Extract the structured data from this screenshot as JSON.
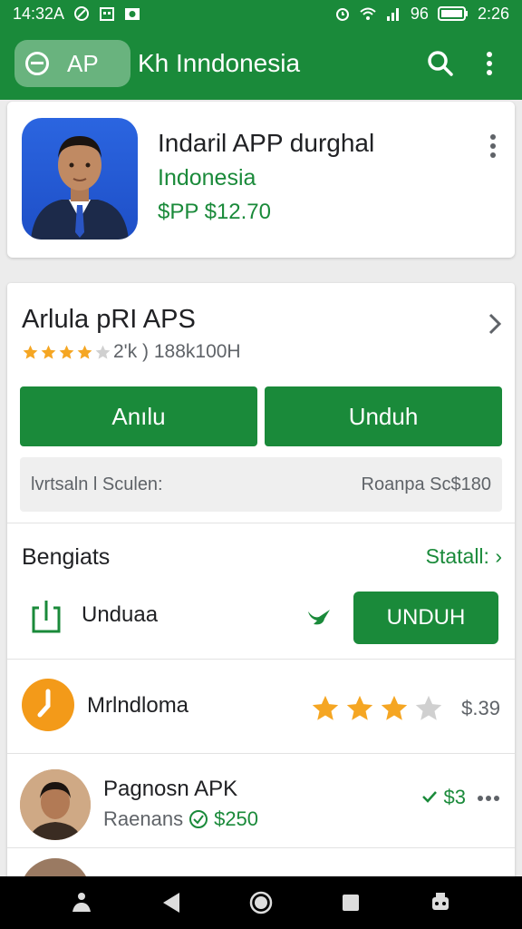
{
  "status_bar": {
    "time_left": "14:32A",
    "battery_text": "96",
    "time_right": "2:26"
  },
  "app_bar": {
    "chip_label": "AP",
    "title": "Kh Inndonesia",
    "icons": [
      "search-icon",
      "more-vert-icon"
    ]
  },
  "app_card": {
    "title": "Indaril APP durghal",
    "developer": "Indonesia",
    "price": "$PP $12.70"
  },
  "details": {
    "title": "Arlula pRI APS",
    "rating_text": "2'k ) 188k100H",
    "rating_stars": 4,
    "button_left": "Anılu",
    "button_right": "Unduh",
    "info_left": "lvrtsaln l Sculen:",
    "info_right": "Roanpa Sc$180",
    "section_title": "Bengiats",
    "section_link": "Statall:",
    "download_row_label": "Unduaa",
    "download_button": "UNDUH",
    "item_row": {
      "label": "Mrlndloma",
      "stars": 3,
      "price": "$.39"
    },
    "apk_row": {
      "title": "Pagnosn APK",
      "subtitle": "Raenans",
      "subtitle_price": "$250",
      "price": "$3"
    }
  },
  "colors": {
    "primary": "#1a8a3a",
    "star": "#f5a623",
    "orange": "#f39a19"
  }
}
